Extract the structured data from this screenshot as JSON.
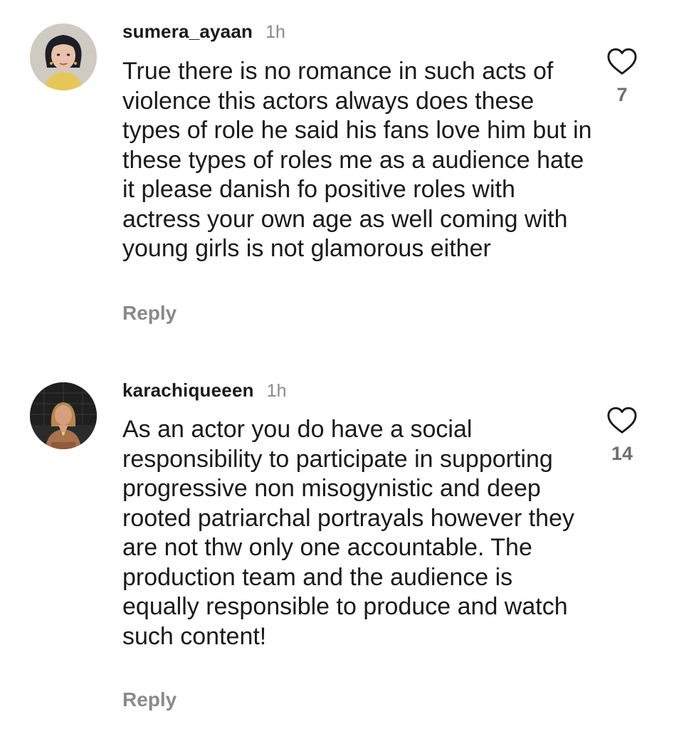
{
  "comments": [
    {
      "username": "sumera_ayaan",
      "time": "1h",
      "text": "True there is no romance in such acts of violence this actors always does these types of role he said his fans love him but in these types of roles me as a audience hate it please danish fo positive roles with actress your own age as well coming with young girls is not glamorous either",
      "reply_label": "Reply",
      "likes": "7",
      "like_icon": "heart-outline-icon"
    },
    {
      "username": "karachiqueeen",
      "time": "1h",
      "text": "As an actor you do have a social responsibility to participate in supporting progressive non misogynistic and deep rooted patriarchal portrayals however they are not thw only one accountable. The production team and the audience is equally responsible to produce and watch such content!",
      "reply_label": "Reply",
      "likes": "14",
      "like_icon": "heart-outline-icon"
    }
  ],
  "colors": {
    "text": "#1a1a1a",
    "muted": "#8a8a8a",
    "background": "#ffffff"
  }
}
